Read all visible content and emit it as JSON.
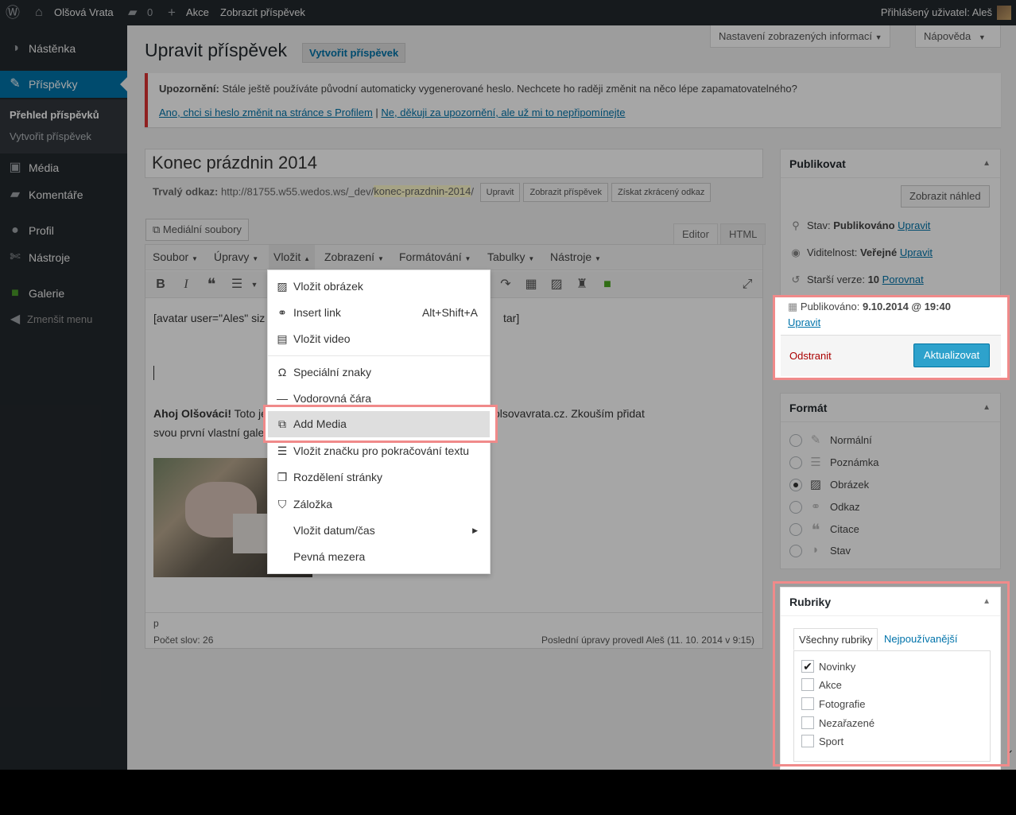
{
  "adminbar": {
    "site": "Olšová Vrata",
    "comments": "0",
    "new": "Akce",
    "view": "Zobrazit příspěvek",
    "user": "Přihlášený uživatel: Aleš"
  },
  "sidebar": {
    "items": [
      {
        "label": "Nástěnka",
        "icon": "dashboard-icon"
      },
      {
        "label": "Příspěvky",
        "icon": "pin-icon"
      },
      {
        "label": "Média",
        "icon": "media-icon"
      },
      {
        "label": "Komentáře",
        "icon": "comment-icon"
      },
      {
        "label": "Profil",
        "icon": "user-icon"
      },
      {
        "label": "Nástroje",
        "icon": "wrench-icon"
      },
      {
        "label": "Galerie",
        "icon": "gallery-icon"
      },
      {
        "label": "Zmenšit menu",
        "icon": "collapse-icon"
      }
    ],
    "sub": [
      "Přehled příspěvků",
      "Vytvořit příspěvek"
    ]
  },
  "header": {
    "title": "Upravit příspěvek",
    "add_new": "Vytvořit příspěvek",
    "screen_options": "Nastavení zobrazených informací",
    "help": "Nápověda"
  },
  "notice": {
    "strong": "Upozornění:",
    "text": " Stále ještě používáte původní automaticky vygenerované heslo. Nechcete ho raději změnit na něco lépe zapamatovatelného?",
    "link1": "Ano, chci si heslo změnit na stránce s Profilem",
    "sep": " | ",
    "link2": "Ne, děkuji za upozornění, ale už mi to nepřipomínejte"
  },
  "post": {
    "title": "Konec prázdnin 2014",
    "permalink_label": "Trvalý odkaz:",
    "permalink_base": "http://81755.w55.wedos.ws/_dev/",
    "permalink_slug": "konec-prazdnin-2014",
    "permalink_end": "/",
    "btn_edit": "Upravit",
    "btn_view": "Zobrazit příspěvek",
    "btn_short": "Získat zkrácený odkaz"
  },
  "editor": {
    "media_btn": "Mediální soubory",
    "tab_visual": "Editor",
    "tab_html": "HTML",
    "menu": [
      "Soubor",
      "Úpravy",
      "Vložit",
      "Zobrazení",
      "Formátování",
      "Tabulky",
      "Nástroje"
    ],
    "line1a": "[avatar user=\"Ales\" siz",
    "line1b": "tar]",
    "bold": "Ahoj Olšováci!",
    "line2a": " Toto je",
    "line2b": "olsovavrata.cz. Zkouším přidat",
    "line3": "svou první vlastní gale",
    "path": "p",
    "wordcount": "Počet slov: 26",
    "lastedit": "Poslední úpravy provedl Aleš (11. 10. 2014 v 9:15)"
  },
  "dropdown": {
    "items": [
      {
        "label": "Vložit obrázek",
        "icon": "image-icon"
      },
      {
        "label": "Insert link",
        "icon": "link-icon",
        "shortcut": "Alt+Shift+A"
      },
      {
        "label": "Vložit video",
        "icon": "video-icon"
      },
      {
        "label": "Speciální znaky",
        "icon": "omega-icon"
      },
      {
        "label": "Vodorovná čára",
        "icon": "hr-icon"
      },
      {
        "label": "Add Media",
        "icon": "add-media-icon"
      },
      {
        "label": "Vložit značku pro pokračování textu",
        "icon": "more-tag-icon"
      },
      {
        "label": "Rozdělení stránky",
        "icon": "page-break-icon"
      },
      {
        "label": "Záložka",
        "icon": "bookmark-icon"
      },
      {
        "label": "Vložit datum/čas",
        "icon": ""
      },
      {
        "label": "Pevná mezera",
        "icon": ""
      }
    ]
  },
  "publish": {
    "title": "Publikovat",
    "preview": "Zobrazit náhled",
    "status_label": "Stav: ",
    "status": "Publikováno",
    "visibility_label": "Viditelnost: ",
    "visibility": "Veřejné",
    "revisions_label": "Starší verze: ",
    "revisions": "10",
    "compare": "Porovnat",
    "published_label": "Publikováno: ",
    "published": "9.10.2014 @ 19:40",
    "edit": "Upravit",
    "delete": "Odstranit",
    "update": "Aktualizovat"
  },
  "format": {
    "title": "Formát",
    "options": [
      {
        "label": "Normální",
        "icon": "pin-icon"
      },
      {
        "label": "Poznámka",
        "icon": "aside-icon"
      },
      {
        "label": "Obrázek",
        "icon": "image-icon",
        "checked": true
      },
      {
        "label": "Odkaz",
        "icon": "link-icon"
      },
      {
        "label": "Citace",
        "icon": "quote-icon"
      },
      {
        "label": "Stav",
        "icon": "status-icon"
      }
    ]
  },
  "categories": {
    "title": "Rubriky",
    "tab_all": "Všechny rubriky",
    "tab_popular": "Nejpoužívanější",
    "items": [
      {
        "label": "Novinky",
        "checked": true
      },
      {
        "label": "Akce"
      },
      {
        "label": "Fotografie"
      },
      {
        "label": "Nezařazené"
      },
      {
        "label": "Sport"
      }
    ]
  }
}
